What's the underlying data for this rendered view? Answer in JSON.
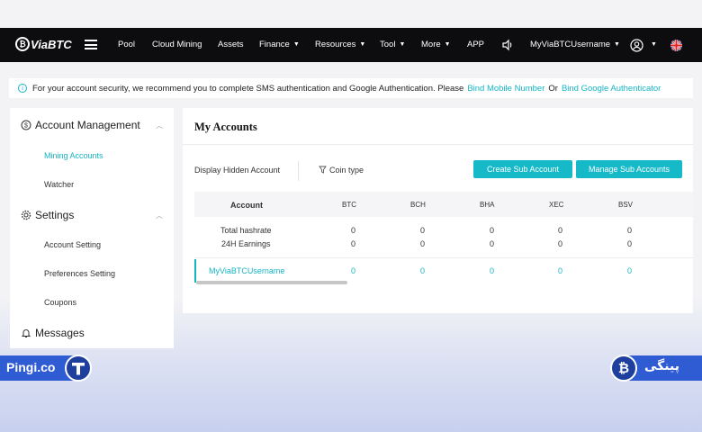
{
  "nav": {
    "logo": "ViaBTC",
    "items": [
      "Pool",
      "Cloud Mining",
      "Assets",
      "Finance",
      "Resources",
      "Tool",
      "More",
      "APP"
    ],
    "username": "MyViaBTCUsername"
  },
  "notice": {
    "text": "For your account security, we recommend you to complete SMS authentication and Google Authentication. Please",
    "link1": "Bind Mobile Number",
    "or": "Or",
    "link2": "Bind Google Authenticator"
  },
  "sidebar": {
    "account_management": "Account Management",
    "mining_accounts": "Mining Accounts",
    "watcher": "Watcher",
    "settings": "Settings",
    "account_setting": "Account Setting",
    "preferences_setting": "Preferences Setting",
    "coupons": "Coupons",
    "messages": "Messages"
  },
  "main": {
    "title": "My Accounts",
    "display_hidden": "Display Hidden Account",
    "coin_type": "Coin type",
    "create_sub": "Create Sub Account",
    "manage_sub": "Manage Sub Accounts",
    "columns": [
      "Account",
      "BTC",
      "BCH",
      "BHA",
      "XEC",
      "BSV"
    ],
    "total_hashrate_label": "Total hashrate",
    "earnings_label": "24H Earnings",
    "total_hashrate": [
      "0",
      "0",
      "0",
      "0",
      "0"
    ],
    "earnings": [
      "0",
      "0",
      "0",
      "0",
      "0"
    ],
    "sub_account": "MyViaBTCUsername",
    "sub_values": [
      "0",
      "0",
      "0",
      "0",
      "0"
    ]
  },
  "watermark": {
    "left": "Pingi.co",
    "right": "پینگی",
    "right_coin": "₿"
  },
  "colors": {
    "accent": "#15b4c4",
    "navbar": "#0d0d0f",
    "watermark": "#2f5bd3"
  }
}
